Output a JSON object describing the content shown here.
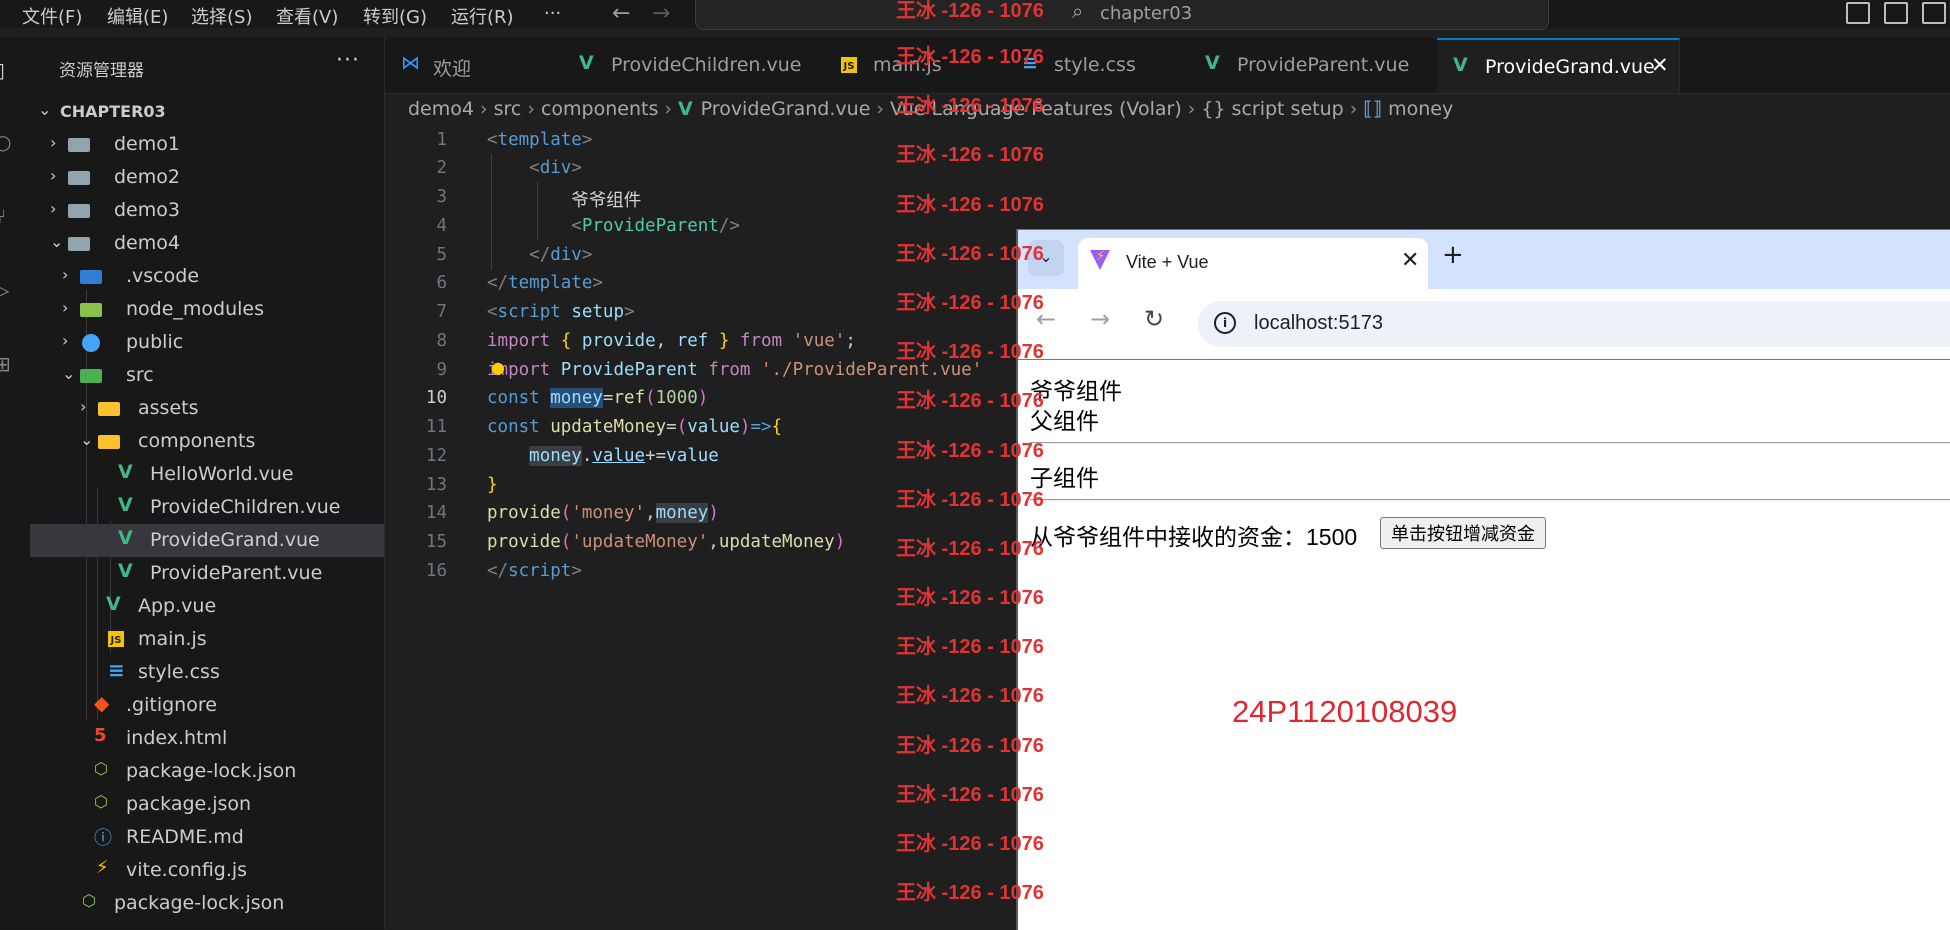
{
  "menu": {
    "items": [
      "文件(F)",
      "编辑(E)",
      "选择(S)",
      "查看(V)",
      "转到(G)",
      "运行(R)"
    ],
    "more": "···",
    "search_text": "chapter03"
  },
  "sidebar": {
    "title": "资源管理器",
    "more": "···",
    "root": "CHAPTER03",
    "items": [
      {
        "label": "demo1"
      },
      {
        "label": "demo2"
      },
      {
        "label": "demo3"
      },
      {
        "label": "demo4"
      },
      {
        "label": ".vscode"
      },
      {
        "label": "node_modules"
      },
      {
        "label": "public"
      },
      {
        "label": "src"
      },
      {
        "label": "assets"
      },
      {
        "label": "components"
      },
      {
        "label": "HelloWorld.vue"
      },
      {
        "label": "ProvideChildren.vue"
      },
      {
        "label": "ProvideGrand.vue"
      },
      {
        "label": "ProvideParent.vue"
      },
      {
        "label": "App.vue"
      },
      {
        "label": "main.js"
      },
      {
        "label": "style.css"
      },
      {
        "label": ".gitignore"
      },
      {
        "label": "index.html"
      },
      {
        "label": "package-lock.json"
      },
      {
        "label": "package.json"
      },
      {
        "label": "README.md"
      },
      {
        "label": "vite.config.js"
      },
      {
        "label": "package-lock.json"
      }
    ]
  },
  "tabs": [
    {
      "label": "欢迎"
    },
    {
      "label": "ProvideChildren.vue"
    },
    {
      "label": "main.js"
    },
    {
      "label": "style.css"
    },
    {
      "label": "ProvideParent.vue"
    },
    {
      "label": "ProvideGrand.vue",
      "close": "✕"
    }
  ],
  "breadcrumb": [
    "demo4",
    "src",
    "components",
    "ProvideGrand.vue",
    "Vue Language Features (Volar)",
    "{} script setup",
    "money"
  ],
  "editor": {
    "line_numbers": [
      "1",
      "2",
      "3",
      "4",
      "5",
      "6",
      "7",
      "8",
      "9",
      "10",
      "11",
      "12",
      "13",
      "14",
      "15",
      "16"
    ],
    "current_line": "10"
  },
  "watermark": "王冰 -126 - 1076",
  "browser": {
    "tab_title": "Vite + Vue",
    "url": "localhost:5173",
    "page": {
      "grand_label": "爷爷组件",
      "parent_label": "父组件",
      "child_label": "子组件",
      "received_text": "从爷爷组件中接收的资金：1500",
      "button_label": "单击按钮增减资金",
      "student_id": "24P1120108039"
    }
  }
}
